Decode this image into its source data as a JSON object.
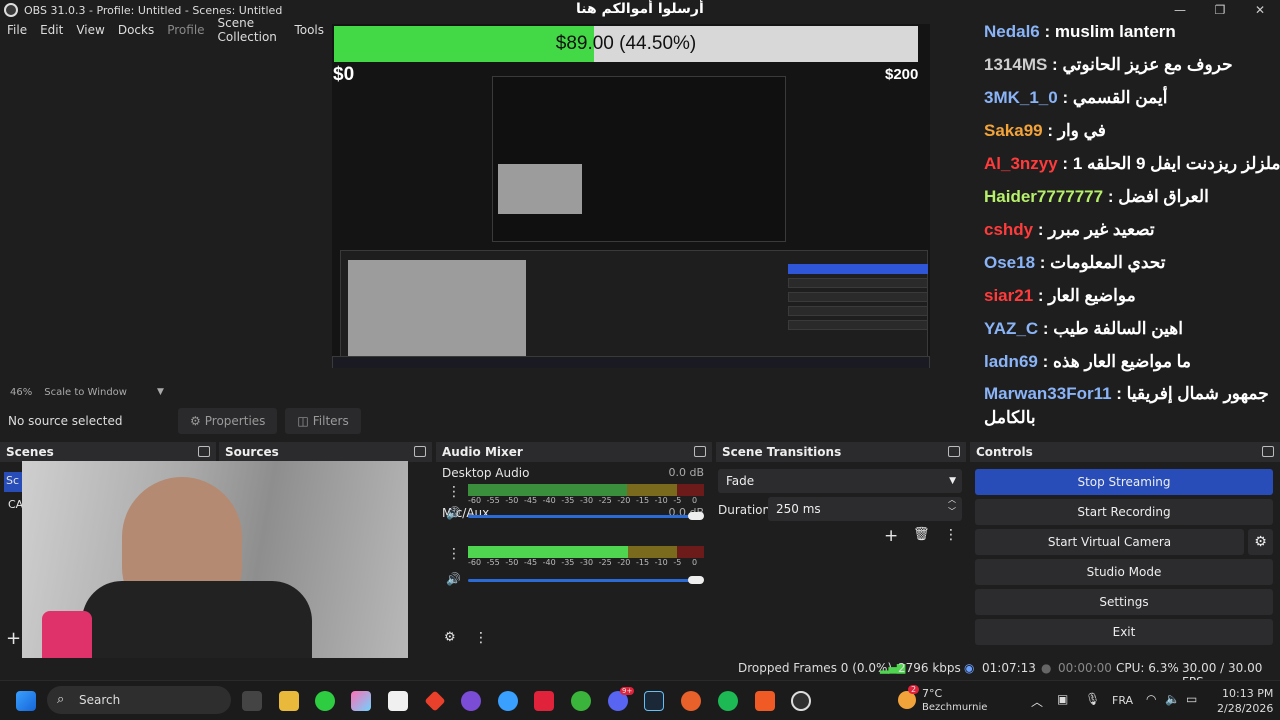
{
  "window": {
    "title": "OBS 31.0.3 - Profile: Untitled - Scenes: Untitled",
    "overlay_title": "أرسلوا أموالكم هنا",
    "minimize": "—",
    "maximize": "❐",
    "close": "✕"
  },
  "menu": [
    "File",
    "Edit",
    "View",
    "Docks",
    "Profile",
    "Scene Collection",
    "Tools"
  ],
  "goal": {
    "label": "$89.00 (44.50%)",
    "progress_fraction": 0.445,
    "min_label": "$0",
    "max_label": "$200",
    "fill_color": "#43d845"
  },
  "chat": [
    {
      "user": "Nedal6",
      "sep": " : ",
      "msg": "muslim lantern",
      "color": "#8ab4f8"
    },
    {
      "user": "1314MS",
      "sep": " : ",
      "msg": "حروف مع عزيز الحانوتي",
      "color": "#cfcfcf"
    },
    {
      "user": "3MK_1_0",
      "sep": " : ",
      "msg": "أيمن القسمي",
      "color": "#8ab4f8"
    },
    {
      "user": "Saka99",
      "sep": " : ",
      "msg": "في وار",
      "color": "#f2a33a"
    },
    {
      "user": "Al_3nzyy",
      "sep": " : ",
      "msg": "ملزلز ريزدنت ايفل 9 الحلقه 1",
      "color": "#ff3b3b"
    },
    {
      "user": "Haider7777777",
      "sep": " : ",
      "msg": "العراق افضل",
      "color": "#b6f06a"
    },
    {
      "user": "cshdy",
      "sep": " : ",
      "msg": "تصعيد غير مبرر",
      "color": "#ff3b3b"
    },
    {
      "user": "Ose18",
      "sep": " : ",
      "msg": "تحدي المعلومات",
      "color": "#8ab4f8"
    },
    {
      "user": "siar21",
      "sep": " : ",
      "msg": "مواضيع العار",
      "color": "#ff3b3b"
    },
    {
      "user": "YAZ_C",
      "sep": " : ",
      "msg": "اهين السالفة طيب",
      "color": "#8ab4f8"
    },
    {
      "user": "ladn69",
      "sep": " : ",
      "msg": "ما مواضيع العار هذه",
      "color": "#8ab4f8"
    },
    {
      "user": "Marwan33For11",
      "sep": " : ",
      "msg": "جمهور شمال إفريقيا بالكامل",
      "color": "#8ab4f8"
    }
  ],
  "zoom": {
    "percent": "46%",
    "mode": "Scale to Window"
  },
  "source_toolbar": {
    "no_source": "No source selected",
    "properties": "Properties",
    "filters": "Filters"
  },
  "docks": {
    "scenes": {
      "title": "Scenes",
      "items": [
        "Sc",
        "CA"
      ]
    },
    "sources": {
      "title": "Sources"
    },
    "mixer": {
      "title": "Audio Mixer",
      "tracks": [
        {
          "name": "Desktop Audio",
          "db": "0.0 dB",
          "level_fraction": 0
        },
        {
          "name": "Mic/Aux",
          "db": "0.0 dB",
          "level_fraction": 0.68
        }
      ],
      "scale": [
        "-60",
        "-55",
        "-50",
        "-45",
        "-40",
        "-35",
        "-30",
        "-25",
        "-20",
        "-15",
        "-10",
        "-5",
        "0"
      ]
    },
    "transitions": {
      "title": "Scene Transitions",
      "selected": "Fade",
      "duration_label": "Duration",
      "duration": "250 ms"
    },
    "controls": {
      "title": "Controls",
      "buttons": [
        "Stop Streaming",
        "Start Recording",
        "Start Virtual Camera",
        "Studio Mode",
        "Settings",
        "Exit"
      ]
    }
  },
  "status": {
    "dropped": "Dropped Frames 0 (0.0%)",
    "bitrate": "2796 kbps",
    "stream_time": "01:07:13",
    "rec_time": "00:00:00",
    "cpu": "CPU: 6.3%",
    "fps": "30.00 / 30.00 FPS"
  },
  "taskbar": {
    "search": "Search",
    "weather_temp": "7°C",
    "weather_loc": "Bezchmurnie",
    "weather_badge": "2",
    "lang": "FRA",
    "time": "10:13 PM",
    "date": "2/28/2026",
    "discord_badge": "9+"
  },
  "colors": {
    "accent_blue": "#284cb8",
    "meter_green": "#3a8f3c"
  }
}
